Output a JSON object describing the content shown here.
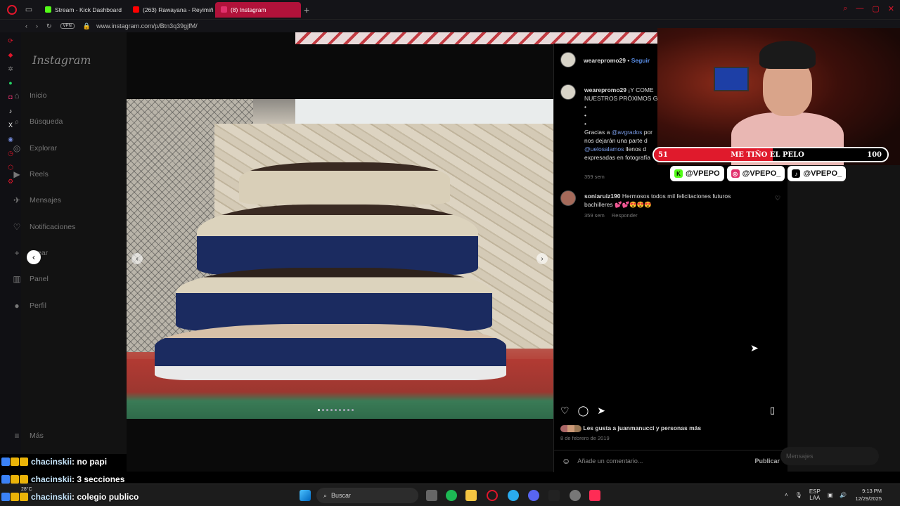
{
  "browser": {
    "tabs": [
      {
        "label": "Stream - Kick Dashboard",
        "color": "#53fc18"
      },
      {
        "label": "(263) Rawayana - Reyimiñ",
        "color": "#ff0000"
      },
      {
        "label": "(8) Instagram",
        "color": "#e1306c"
      }
    ],
    "url": "www.instagram.com/p/Btn3q39gjfM/",
    "vpn_label": "VPN"
  },
  "instagram": {
    "logo": "Instagram",
    "nav": [
      "Inicio",
      "Búsqueda",
      "Explorar",
      "Reels",
      "Mensajes",
      "Notificaciones",
      "Crear",
      "Panel",
      "Perfil"
    ],
    "more": "Más",
    "post": {
      "author": "wearepromo29",
      "follow": "Seguir",
      "caption_user": "wearepromo29",
      "caption_line1": "¡Y COME",
      "caption_line2": "NUESTROS PRÓXIMOS G",
      "bullets": [
        "•",
        "•",
        "•"
      ],
      "thanks_prefix": "Gracias a ",
      "thanks_handle": "@avgrados",
      "thanks_suffix": " por",
      "line_b": "nos dejarán una parte d",
      "handle2": "@uelosalamos",
      "line_c": " llenos d",
      "line_d": "expresadas en fotografía",
      "caption_time": "359 sem",
      "comment_user": "soniaruiz190",
      "comment_text": "Hermosos todos mil felicitaciones futuros",
      "comment_text2": "bachilleres 💕💕😍😍😍",
      "comment_time": "359 sem",
      "reply": "Responder",
      "likes": "Les gusta a juanmanucci y personas más",
      "date": "8 de febrero de 2019",
      "comment_placeholder": "Añade un comentario...",
      "publish": "Publicar",
      "messages_pill": "Mensajes",
      "slide_count": 9,
      "active_slide": 1
    }
  },
  "stream_overlay": {
    "goal_start": "51",
    "goal_text": "ME TIÑO EL PELO",
    "goal_end": "100",
    "goal_progress": 0.51,
    "socials": [
      {
        "platform": "kick",
        "handle": "@VPEPO"
      },
      {
        "platform": "instagram",
        "handle": "@VPEPO_"
      },
      {
        "platform": "tiktok",
        "handle": "@VPEPO_"
      }
    ],
    "chat": [
      {
        "user": "chacinskii",
        "message": ": no papi"
      },
      {
        "user": "chacinskii",
        "message": ": 3 secciones"
      },
      {
        "user": "chacinskii",
        "message": ": colegio publico"
      }
    ]
  },
  "taskbar": {
    "search": "Buscar",
    "lang": "ESP",
    "lang2": "LAA",
    "time": "9:13 PM",
    "date": "12/29/2025",
    "weather": "28°C"
  }
}
